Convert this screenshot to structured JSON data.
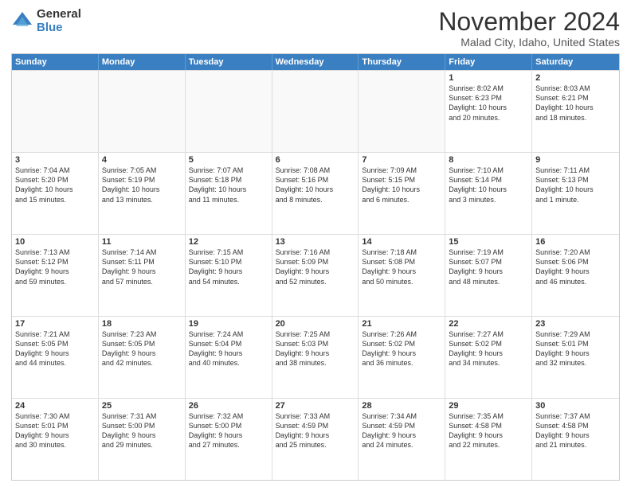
{
  "logo": {
    "general": "General",
    "blue": "Blue"
  },
  "header": {
    "month": "November 2024",
    "location": "Malad City, Idaho, United States"
  },
  "days_of_week": [
    "Sunday",
    "Monday",
    "Tuesday",
    "Wednesday",
    "Thursday",
    "Friday",
    "Saturday"
  ],
  "weeks": [
    [
      {
        "day": "",
        "text": ""
      },
      {
        "day": "",
        "text": ""
      },
      {
        "day": "",
        "text": ""
      },
      {
        "day": "",
        "text": ""
      },
      {
        "day": "",
        "text": ""
      },
      {
        "day": "1",
        "text": "Sunrise: 8:02 AM\nSunset: 6:23 PM\nDaylight: 10 hours\nand 20 minutes."
      },
      {
        "day": "2",
        "text": "Sunrise: 8:03 AM\nSunset: 6:21 PM\nDaylight: 10 hours\nand 18 minutes."
      }
    ],
    [
      {
        "day": "3",
        "text": "Sunrise: 7:04 AM\nSunset: 5:20 PM\nDaylight: 10 hours\nand 15 minutes."
      },
      {
        "day": "4",
        "text": "Sunrise: 7:05 AM\nSunset: 5:19 PM\nDaylight: 10 hours\nand 13 minutes."
      },
      {
        "day": "5",
        "text": "Sunrise: 7:07 AM\nSunset: 5:18 PM\nDaylight: 10 hours\nand 11 minutes."
      },
      {
        "day": "6",
        "text": "Sunrise: 7:08 AM\nSunset: 5:16 PM\nDaylight: 10 hours\nand 8 minutes."
      },
      {
        "day": "7",
        "text": "Sunrise: 7:09 AM\nSunset: 5:15 PM\nDaylight: 10 hours\nand 6 minutes."
      },
      {
        "day": "8",
        "text": "Sunrise: 7:10 AM\nSunset: 5:14 PM\nDaylight: 10 hours\nand 3 minutes."
      },
      {
        "day": "9",
        "text": "Sunrise: 7:11 AM\nSunset: 5:13 PM\nDaylight: 10 hours\nand 1 minute."
      }
    ],
    [
      {
        "day": "10",
        "text": "Sunrise: 7:13 AM\nSunset: 5:12 PM\nDaylight: 9 hours\nand 59 minutes."
      },
      {
        "day": "11",
        "text": "Sunrise: 7:14 AM\nSunset: 5:11 PM\nDaylight: 9 hours\nand 57 minutes."
      },
      {
        "day": "12",
        "text": "Sunrise: 7:15 AM\nSunset: 5:10 PM\nDaylight: 9 hours\nand 54 minutes."
      },
      {
        "day": "13",
        "text": "Sunrise: 7:16 AM\nSunset: 5:09 PM\nDaylight: 9 hours\nand 52 minutes."
      },
      {
        "day": "14",
        "text": "Sunrise: 7:18 AM\nSunset: 5:08 PM\nDaylight: 9 hours\nand 50 minutes."
      },
      {
        "day": "15",
        "text": "Sunrise: 7:19 AM\nSunset: 5:07 PM\nDaylight: 9 hours\nand 48 minutes."
      },
      {
        "day": "16",
        "text": "Sunrise: 7:20 AM\nSunset: 5:06 PM\nDaylight: 9 hours\nand 46 minutes."
      }
    ],
    [
      {
        "day": "17",
        "text": "Sunrise: 7:21 AM\nSunset: 5:05 PM\nDaylight: 9 hours\nand 44 minutes."
      },
      {
        "day": "18",
        "text": "Sunrise: 7:23 AM\nSunset: 5:05 PM\nDaylight: 9 hours\nand 42 minutes."
      },
      {
        "day": "19",
        "text": "Sunrise: 7:24 AM\nSunset: 5:04 PM\nDaylight: 9 hours\nand 40 minutes."
      },
      {
        "day": "20",
        "text": "Sunrise: 7:25 AM\nSunset: 5:03 PM\nDaylight: 9 hours\nand 38 minutes."
      },
      {
        "day": "21",
        "text": "Sunrise: 7:26 AM\nSunset: 5:02 PM\nDaylight: 9 hours\nand 36 minutes."
      },
      {
        "day": "22",
        "text": "Sunrise: 7:27 AM\nSunset: 5:02 PM\nDaylight: 9 hours\nand 34 minutes."
      },
      {
        "day": "23",
        "text": "Sunrise: 7:29 AM\nSunset: 5:01 PM\nDaylight: 9 hours\nand 32 minutes."
      }
    ],
    [
      {
        "day": "24",
        "text": "Sunrise: 7:30 AM\nSunset: 5:01 PM\nDaylight: 9 hours\nand 30 minutes."
      },
      {
        "day": "25",
        "text": "Sunrise: 7:31 AM\nSunset: 5:00 PM\nDaylight: 9 hours\nand 29 minutes."
      },
      {
        "day": "26",
        "text": "Sunrise: 7:32 AM\nSunset: 5:00 PM\nDaylight: 9 hours\nand 27 minutes."
      },
      {
        "day": "27",
        "text": "Sunrise: 7:33 AM\nSunset: 4:59 PM\nDaylight: 9 hours\nand 25 minutes."
      },
      {
        "day": "28",
        "text": "Sunrise: 7:34 AM\nSunset: 4:59 PM\nDaylight: 9 hours\nand 24 minutes."
      },
      {
        "day": "29",
        "text": "Sunrise: 7:35 AM\nSunset: 4:58 PM\nDaylight: 9 hours\nand 22 minutes."
      },
      {
        "day": "30",
        "text": "Sunrise: 7:37 AM\nSunset: 4:58 PM\nDaylight: 9 hours\nand 21 minutes."
      }
    ]
  ]
}
